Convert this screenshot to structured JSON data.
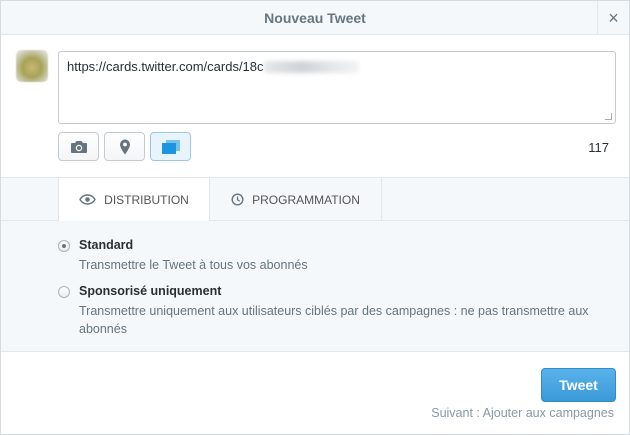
{
  "dialog": {
    "title": "Nouveau Tweet",
    "close_label": "×"
  },
  "compose": {
    "text_visible": "https://cards.twitter.com/cards/18c",
    "counter": "117"
  },
  "toolbar": {
    "photo_icon": "camera-icon",
    "location_icon": "location-pin-icon",
    "card_icon": "card-icon",
    "card_color": "#1b95e0"
  },
  "tabs": [
    {
      "label": "DISTRIBUTION",
      "icon": "eye-icon",
      "active": true
    },
    {
      "label": "PROGRAMMATION",
      "icon": "clock-icon",
      "active": false
    }
  ],
  "options": [
    {
      "label": "Standard",
      "description": "Transmettre le Tweet à tous vos abonnés",
      "selected": true
    },
    {
      "label": "Sponsorisé uniquement",
      "description": "Transmettre uniquement aux utilisateurs ciblés par des campagnes : ne pas transmettre aux abonnés",
      "selected": false
    }
  ],
  "footer": {
    "tweet_button": "Tweet",
    "next_hint": "Suivant : Ajouter aux campagnes"
  },
  "colors": {
    "accent": "#55acee",
    "panel_bg": "#f5f8fa"
  }
}
